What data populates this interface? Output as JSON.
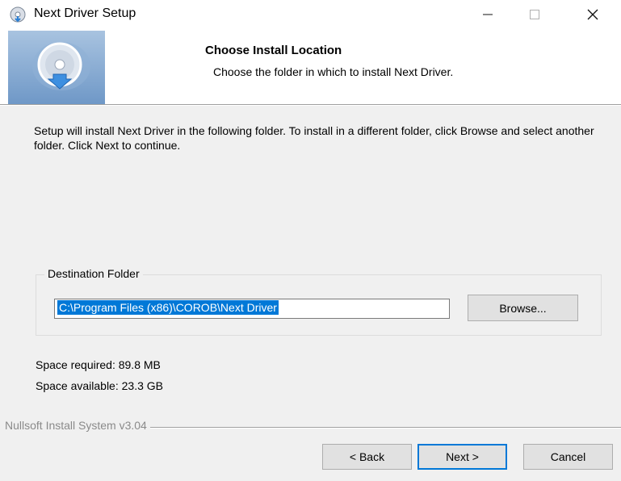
{
  "window": {
    "title": "Next Driver Setup",
    "minimize_glyph": "—",
    "maximize_glyph": "☐",
    "close_glyph": "✕"
  },
  "header": {
    "title": "Choose Install Location",
    "subtitle": "Choose the folder in which to install Next Driver."
  },
  "main": {
    "intro": "Setup will install Next Driver in the following folder. To install in a different folder, click Browse and select another folder. Click Next to continue.",
    "destination": {
      "group_label": "Destination Folder",
      "path_value": "C:\\Program Files (x86)\\COROB\\Next Driver",
      "browse_label": "Browse..."
    },
    "space_required": "Space required: 89.8 MB",
    "space_available": "Space available: 23.3 GB"
  },
  "footer": {
    "brand": "Nullsoft Install System v3.04",
    "back_label": "< Back",
    "next_label": "Next >",
    "cancel_label": "Cancel"
  },
  "colors": {
    "accent": "#0078d7",
    "dialog_bg": "#f0f0f0",
    "button_bg": "#e1e1e1"
  },
  "icons": {
    "app": "installer-disc-icon",
    "header": "install-disc-download-icon"
  }
}
